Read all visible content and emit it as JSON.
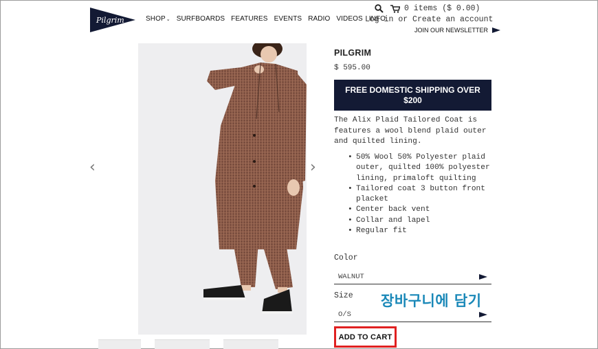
{
  "brand": {
    "logo_text": "Pilgrim",
    "color": "#131a34"
  },
  "nav": {
    "items": [
      {
        "label": "SHOP",
        "has_dropdown": true
      },
      {
        "label": "SURFBOARDS"
      },
      {
        "label": "FEATURES"
      },
      {
        "label": "EVENTS"
      },
      {
        "label": "RADIO"
      },
      {
        "label": "VIDEOS"
      },
      {
        "label": "INFO"
      }
    ]
  },
  "utility": {
    "search_icon": "search-icon",
    "cart_icon": "cart-icon",
    "cart_text": "0 items ($ 0.00)",
    "login": "Log in",
    "or": "or",
    "create_account": "Create an account",
    "newsletter": "JOIN OUR NEWSLETTER"
  },
  "gallery": {
    "prev_icon": "chevron-left-icon",
    "next_icon": "chevron-right-icon",
    "prev_glyph": "‹",
    "next_glyph": "›"
  },
  "product": {
    "vendor": "PILGRIM",
    "price": "$ 595.00",
    "shipping_banner": "FREE DOMESTIC SHIPPING OVER $200",
    "description": "The Alix Plaid Tailored Coat is features a wool blend plaid outer and quilted lining.",
    "features": [
      "50% Wool 50% Polyester plaid outer, quilted 100% polyester lining, primaloft quilting",
      "Tailored coat 3 button front placket",
      "Center back vent",
      "Collar and lapel",
      "Regular fit"
    ],
    "color_label": "Color",
    "color_value": "WALNUT",
    "size_label": "Size",
    "size_value": "O/S",
    "add_to_cart": "ADD TO CART"
  },
  "annotation": {
    "text": "장바구니에 담기",
    "color": "#1a88b8",
    "highlight_color": "#e02020"
  }
}
